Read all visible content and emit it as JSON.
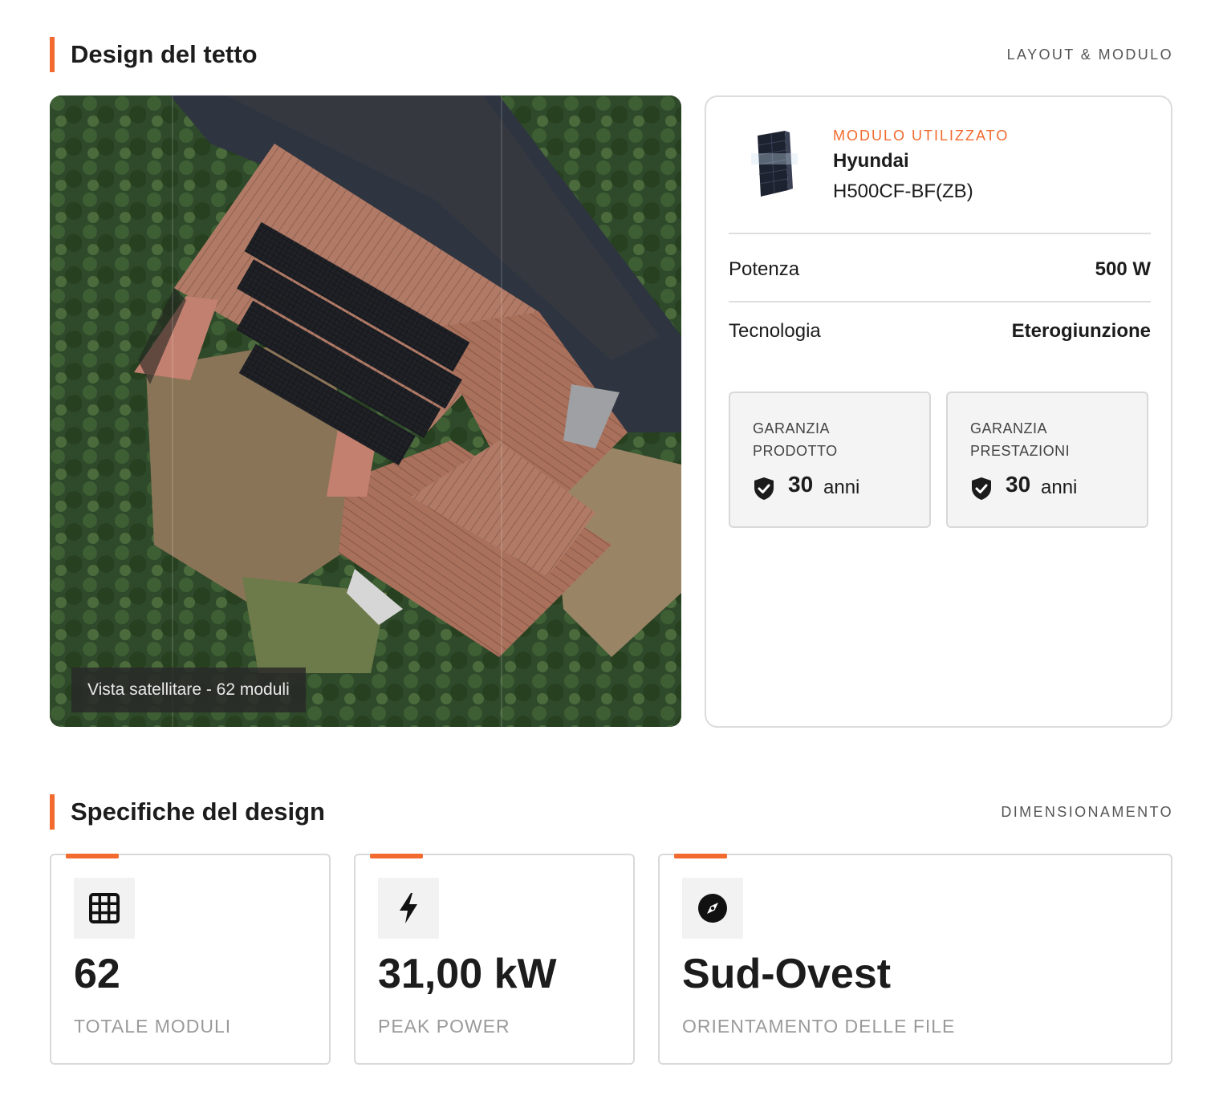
{
  "roof_section": {
    "title": "Design del tetto",
    "label": "LAYOUT & MODULO"
  },
  "map": {
    "caption": "Vista satellitare - 62 moduli"
  },
  "module": {
    "eyebrow": "MODULO UTILIZZATO",
    "brand": "Hyundai",
    "model": "H500CF-BF(ZB)",
    "specs": [
      {
        "label": "Potenza",
        "value": "500 W"
      },
      {
        "label": "Tecnologia",
        "value": "Eterogiunzione"
      }
    ],
    "warranties": [
      {
        "label": "GARANZIA PRODOTTO",
        "years": "30",
        "unit": "anni"
      },
      {
        "label": "GARANZIA PRESTAZIONI",
        "years": "30",
        "unit": "anni"
      }
    ]
  },
  "specs_section": {
    "title": "Specifiche del design",
    "label": "DIMENSIONAMENTO"
  },
  "stats": [
    {
      "value": "62",
      "caption": "TOTALE MODULI",
      "icon": "grid-icon"
    },
    {
      "value": "31,00 kW",
      "caption": "PEAK POWER",
      "icon": "bolt-icon"
    },
    {
      "value": "Sud-Ovest",
      "caption": "ORIENTAMENTO DELLE FILE",
      "icon": "compass-icon"
    }
  ],
  "colors": {
    "accent": "#f26a2e"
  }
}
